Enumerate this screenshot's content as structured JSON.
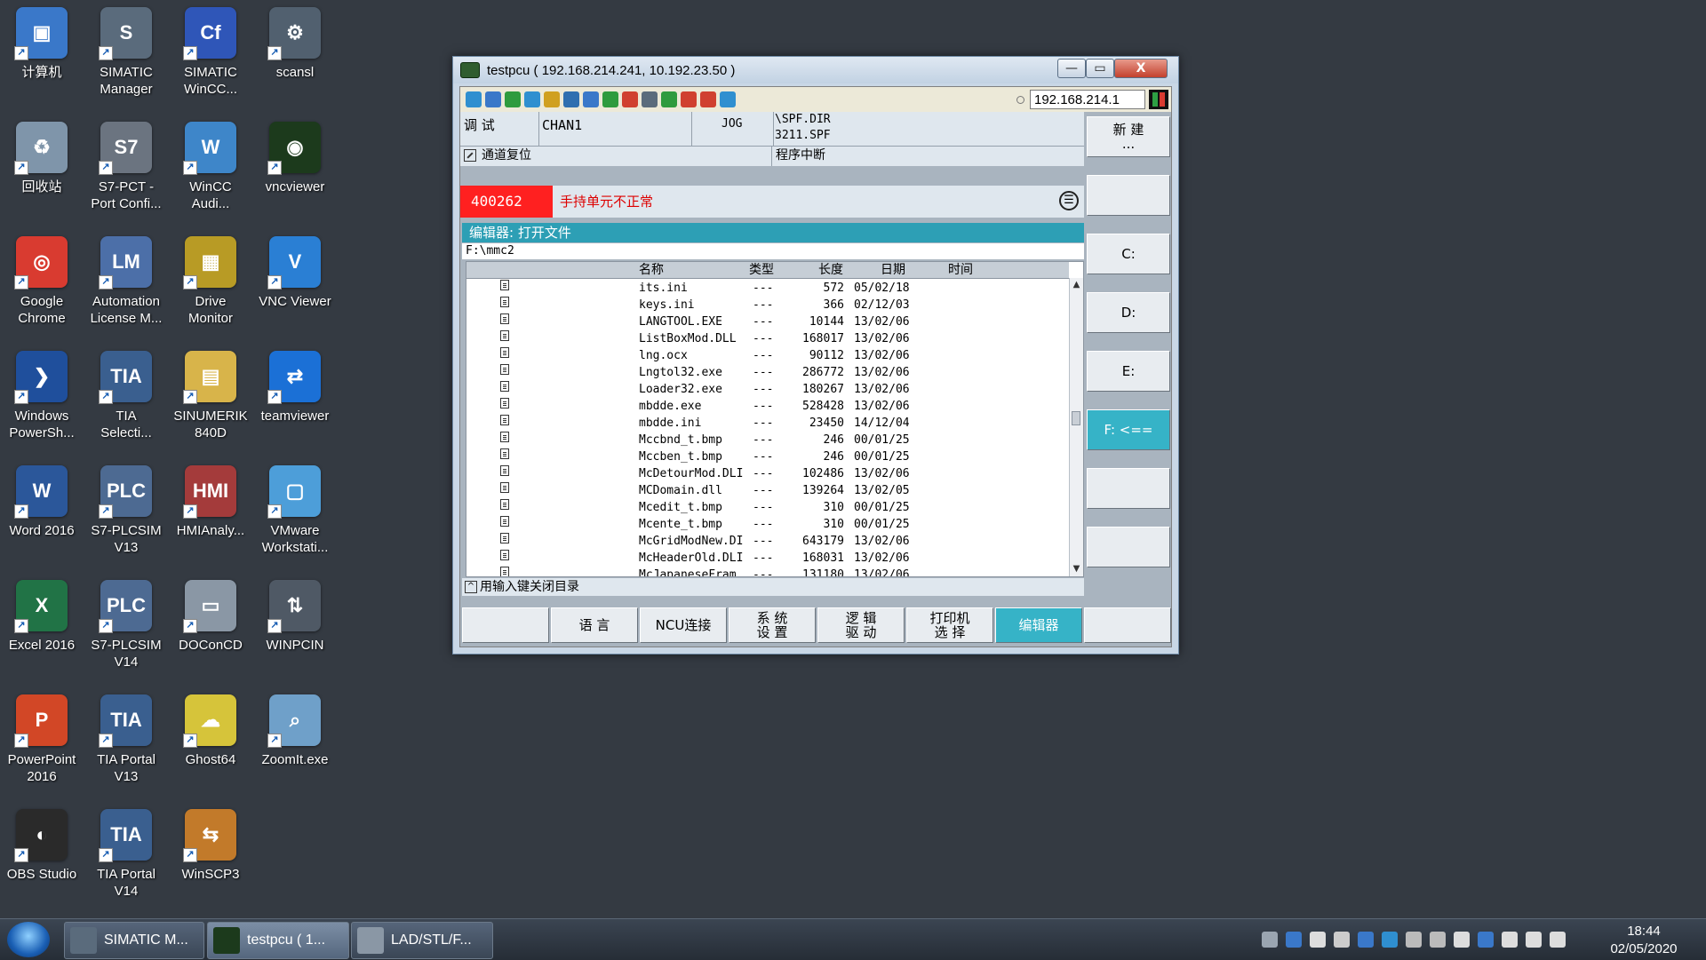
{
  "desktop": {
    "icons": [
      {
        "label": "计算机",
        "icon": "computer-icon",
        "color": "#3a78c9"
      },
      {
        "label": "SIMATIC\nManager",
        "icon": "simatic-manager-icon",
        "color": "#5a6b7c"
      },
      {
        "label": "SIMATIC\nWinCC...",
        "icon": "wincc-icon",
        "color": "#2f56b8"
      },
      {
        "label": "scansl",
        "icon": "network-icon",
        "color": "#51606f"
      },
      {
        "label": "回收站",
        "icon": "recycle-bin-icon",
        "color": "#7f95aa"
      },
      {
        "label": "S7-PCT -\nPort Confi...",
        "icon": "s7-pct-icon",
        "color": "#6b7480"
      },
      {
        "label": "WinCC\nAudi...",
        "icon": "wincc-audit-icon",
        "color": "#3e86c9"
      },
      {
        "label": "vncviewer",
        "icon": "vnc-eye-icon",
        "color": "#1c3a1c"
      },
      {
        "label": "Google\nChrome",
        "icon": "chrome-icon",
        "color": "#d93b30"
      },
      {
        "label": "Automation\nLicense M...",
        "icon": "license-icon",
        "color": "#4c6fa8"
      },
      {
        "label": "Drive\nMonitor",
        "icon": "drive-monitor-icon",
        "color": "#b89b25"
      },
      {
        "label": "VNC Viewer",
        "icon": "vnc-viewer-icon",
        "color": "#2a7fd4"
      },
      {
        "label": "Windows\nPowerSh...",
        "icon": "powershell-icon",
        "color": "#1f4f9c"
      },
      {
        "label": "TIA\nSelecti...",
        "icon": "tia-selection-icon",
        "color": "#3a5f8f"
      },
      {
        "label": "SINUMERIK\n840D",
        "icon": "folder-icon",
        "color": "#d8b44a"
      },
      {
        "label": "teamviewer",
        "icon": "teamviewer-icon",
        "color": "#1b70d6"
      },
      {
        "label": "Word 2016",
        "icon": "word-icon",
        "color": "#2b579a"
      },
      {
        "label": "S7-PLCSIM\nV13",
        "icon": "plcsim-icon",
        "color": "#4d6a92"
      },
      {
        "label": "HMIAnaly...",
        "icon": "hmi-analyzer-icon",
        "color": "#a43b3b"
      },
      {
        "label": "VMware\nWorkstati...",
        "icon": "vmware-icon",
        "color": "#4d9ed9"
      },
      {
        "label": "Excel 2016",
        "icon": "excel-icon",
        "color": "#217346"
      },
      {
        "label": "S7-PLCSIM\nV14",
        "icon": "plcsim-icon",
        "color": "#4d6a92"
      },
      {
        "label": "DOConCD",
        "icon": "doconcd-icon",
        "color": "#8a97a5"
      },
      {
        "label": "WINPCIN",
        "icon": "winpcin-icon",
        "color": "#4f5965"
      },
      {
        "label": "PowerPoint\n2016",
        "icon": "powerpoint-icon",
        "color": "#d24726"
      },
      {
        "label": "TIA Portal\nV13",
        "icon": "tia-portal-icon",
        "color": "#3a5f8f"
      },
      {
        "label": "Ghost64",
        "icon": "ghost-icon",
        "color": "#d6c43a"
      },
      {
        "label": "ZoomIt.exe",
        "icon": "zoomit-icon",
        "color": "#6fa0c9"
      },
      {
        "label": "OBS Studio",
        "icon": "obs-icon",
        "color": "#2a2a2a"
      },
      {
        "label": "TIA Portal\nV14",
        "icon": "tia-portal-icon",
        "color": "#3a5f8f"
      },
      {
        "label": "WinSCP3",
        "icon": "winscp-icon",
        "color": "#c27a2a"
      }
    ],
    "icon_glyphs": [
      "▣",
      "S",
      "Cf",
      "⚙",
      "♻",
      "S7",
      "W",
      "◉",
      "◎",
      "LM",
      "▦",
      "V",
      "❯",
      "TIA",
      "▤",
      "⇄",
      "W",
      "PLC",
      "HMI",
      "▢",
      "X",
      "PLC",
      "▭",
      "⇅",
      "P",
      "TIA",
      "☁",
      "⌕",
      "◐",
      "TIA",
      "⇆"
    ]
  },
  "window": {
    "title": "testpcu ( 192.168.214.241, 10.192.23.50 )",
    "minimize": "—",
    "maximize": "▭",
    "close": "X",
    "toolbar": {
      "icon_colors": [
        "#2f8fd0",
        "#3a78c9",
        "#2e9b3e",
        "#2f8fd0",
        "#d0a020",
        "#2f6fb0",
        "#3a78c9",
        "#2e9b3e",
        "#d04030",
        "#5a6b7c",
        "#2e9b3e",
        "#d04030",
        "#d04030",
        "#2f8fd0"
      ],
      "ip_address": "192.168.214.1"
    }
  },
  "hmi": {
    "mode": "调 试",
    "channel": "CHAN1",
    "op_mode": "JOG",
    "program_path_1": "\\SPF.DIR",
    "program_path_2": "3211.SPF",
    "channel_status": "通道复位",
    "program_status": "程序中断",
    "alarm_number": "400262",
    "alarm_text": "手持单元不正常",
    "alarm_ack_icon": "☰",
    "editor_header": "编辑器: 打开文件",
    "current_path": "F:\\mmc2",
    "columns": {
      "name": "名称",
      "type": "类型",
      "length": "长度",
      "date": "日期",
      "time": "时间"
    },
    "files": [
      {
        "name": "its.ini",
        "type": "---",
        "length": "572",
        "date": "05/02/18"
      },
      {
        "name": "keys.ini",
        "type": "---",
        "length": "366",
        "date": "02/12/03"
      },
      {
        "name": "LANGTOOL.EXE",
        "type": "---",
        "length": "10144",
        "date": "13/02/06"
      },
      {
        "name": "ListBoxMod.DLL",
        "type": "---",
        "length": "168017",
        "date": "13/02/06"
      },
      {
        "name": "lng.ocx",
        "type": "---",
        "length": "90112",
        "date": "13/02/06"
      },
      {
        "name": "Lngtol32.exe",
        "type": "---",
        "length": "286772",
        "date": "13/02/06"
      },
      {
        "name": "Loader32.exe",
        "type": "---",
        "length": "180267",
        "date": "13/02/06"
      },
      {
        "name": "mbdde.exe",
        "type": "---",
        "length": "528428",
        "date": "13/02/06"
      },
      {
        "name": "mbdde.ini",
        "type": "---",
        "length": "23450",
        "date": "14/12/04"
      },
      {
        "name": "Mccbnd_t.bmp",
        "type": "---",
        "length": "246",
        "date": "00/01/25"
      },
      {
        "name": "Mccben_t.bmp",
        "type": "---",
        "length": "246",
        "date": "00/01/25"
      },
      {
        "name": "McDetourMod.DLI",
        "type": "---",
        "length": "102486",
        "date": "13/02/06"
      },
      {
        "name": "MCDomain.dll",
        "type": "---",
        "length": "139264",
        "date": "13/02/05"
      },
      {
        "name": "Mcedit_t.bmp",
        "type": "---",
        "length": "310",
        "date": "00/01/25"
      },
      {
        "name": "Mcente_t.bmp",
        "type": "---",
        "length": "310",
        "date": "00/01/25"
      },
      {
        "name": "McGridModNew.DI",
        "type": "---",
        "length": "643179",
        "date": "13/02/06"
      },
      {
        "name": "McHeaderOld.DLI",
        "type": "---",
        "length": "168031",
        "date": "13/02/06"
      },
      {
        "name": "McJapaneseFram",
        "type": "---",
        "length": "131180",
        "date": "13/02/06"
      }
    ],
    "close_hint": "用输入键关闭目录",
    "close_hint_chevron": "^",
    "scroll_up": "▲",
    "scroll_down": "▼",
    "vertical_softkeys": [
      "新 建\n...",
      "",
      "C:",
      "D:",
      "E:",
      "F: <==",
      "",
      ""
    ],
    "horizontal_softkeys": [
      "",
      "语 言",
      "NCU连接",
      "系 统\n设 置",
      "逻 辑\n驱 动",
      "打印机\n选 择",
      "编辑器",
      ""
    ]
  },
  "taskbar": {
    "tasks": [
      {
        "label": "SIMATIC M...",
        "color": "#5a6b7c"
      },
      {
        "label": "testpcu ( 1...",
        "color": "#1c3a1c"
      },
      {
        "label": "LAD/STL/F...",
        "color": "#8a97a5"
      }
    ],
    "tray_colors": [
      "#9aa5b1",
      "#3a78c9",
      "#dddddd",
      "#cccccc",
      "#3a78c9",
      "#2f8fd0",
      "#bbbbbb",
      "#bbbbbb",
      "#dddddd",
      "#3a78c9",
      "#dddddd",
      "#dddddd",
      "#dddddd"
    ],
    "time": "18:44",
    "date": "02/05/2020"
  },
  "colors": {
    "accent": "#36b3c7",
    "alarm": "#ff2020",
    "header": "#2d9fb5"
  }
}
